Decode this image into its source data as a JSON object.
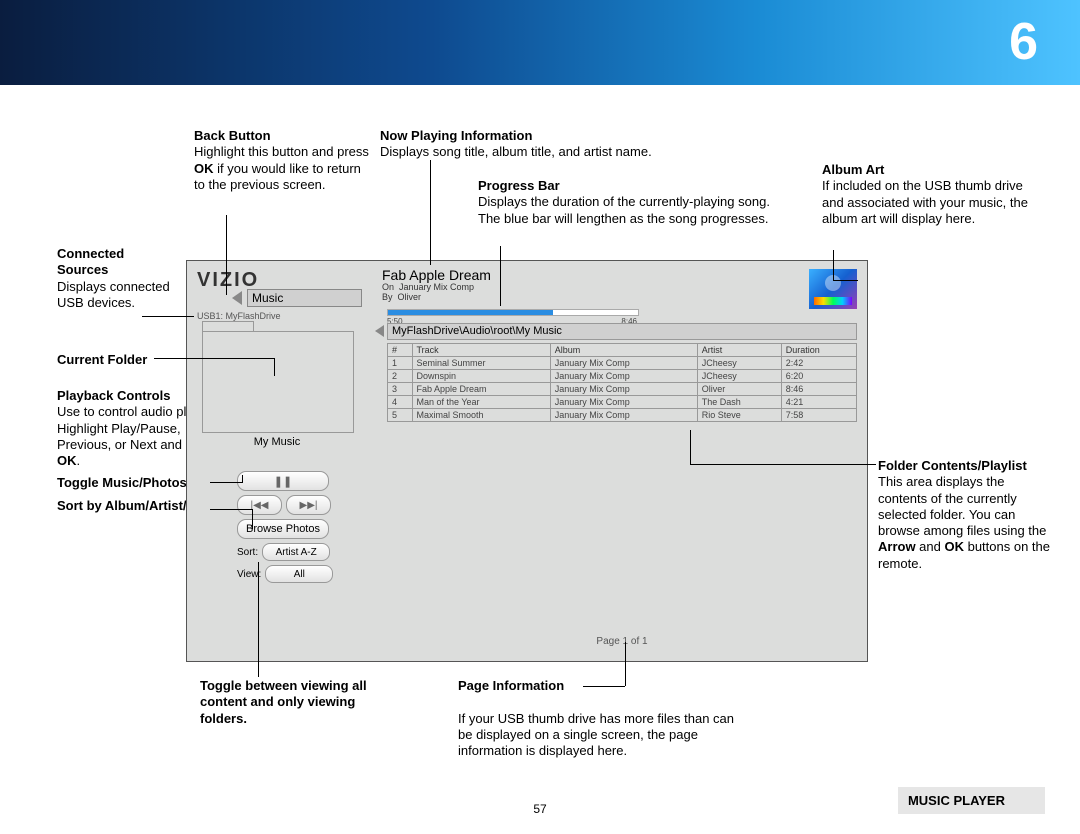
{
  "chapter_number": "6",
  "page_number": "57",
  "footer": "MUSIC PLAYER",
  "callouts": {
    "back": {
      "title": "Back Button",
      "body": "Highlight this button and press OK if you would like to return to the previous screen."
    },
    "np": {
      "title": "Now Playing Information",
      "body": "Displays song title, album title, and artist name."
    },
    "pb": {
      "title": "Progress Bar",
      "body": "Displays the duration of the currently-playing song. The blue bar will lengthen as the song progresses."
    },
    "art": {
      "title": "Album Art",
      "body": "If included on the USB thumb drive and associated with your music, the album art will display here."
    },
    "src": {
      "title": "Connected Sources",
      "body": "Displays connected USB devices."
    },
    "cf": {
      "title": "Current Folder"
    },
    "pc": {
      "title": "Playback Controls",
      "body": "Use to control audio playback. Highlight Play/Pause, Previous, or Next and press OK."
    },
    "toggle": {
      "title": "Toggle Music/Photos"
    },
    "sort": {
      "title": "Sort by Album/Artist/Track"
    },
    "view": {
      "title": "Toggle between viewing all content and only viewing folders."
    },
    "pi": {
      "title": "Page Information",
      "body": "If your USB thumb drive has more files than can be displayed on a single screen, the page information is displayed here."
    },
    "fc": {
      "title": "Folder Contents/Playlist",
      "body": "This area displays the contents of the currently selected folder. You can browse among files using the Arrow and OK buttons on the remote."
    }
  },
  "screen": {
    "logo": "VIZIO",
    "music_label": "Music",
    "usb": "USB1: MyFlashDrive",
    "folder": "My Music",
    "browse": "Browse Photos",
    "sort_label": "Sort:",
    "sort_value": "Artist A-Z",
    "view_label": "View:",
    "view_value": "All",
    "page_info": "Page 1 of 1",
    "now_playing": {
      "title": "Fab Apple Dream",
      "on": "January Mix Comp",
      "by": "Oliver",
      "elapsed": "5:50",
      "total": "8:46"
    },
    "breadcrumb": "MyFlashDrive\\Audio\\root\\My Music",
    "columns": {
      "n": "#",
      "track": "Track",
      "album": "Album",
      "artist": "Artist",
      "dur": "Duration"
    },
    "tracks": [
      {
        "n": "1",
        "track": "Seminal Summer",
        "album": "January Mix Comp",
        "artist": "JCheesy",
        "dur": "2:42"
      },
      {
        "n": "2",
        "track": "Downspin",
        "album": "January Mix Comp",
        "artist": "JCheesy",
        "dur": "6:20"
      },
      {
        "n": "3",
        "track": "Fab Apple Dream",
        "album": "January Mix Comp",
        "artist": "Oliver",
        "dur": "8:46"
      },
      {
        "n": "4",
        "track": "Man of the Year",
        "album": "January Mix Comp",
        "artist": "The Dash",
        "dur": "4:21"
      },
      {
        "n": "5",
        "track": "Maximal Smooth",
        "album": "January Mix Comp",
        "artist": "Rio Steve",
        "dur": "7:58"
      }
    ]
  }
}
